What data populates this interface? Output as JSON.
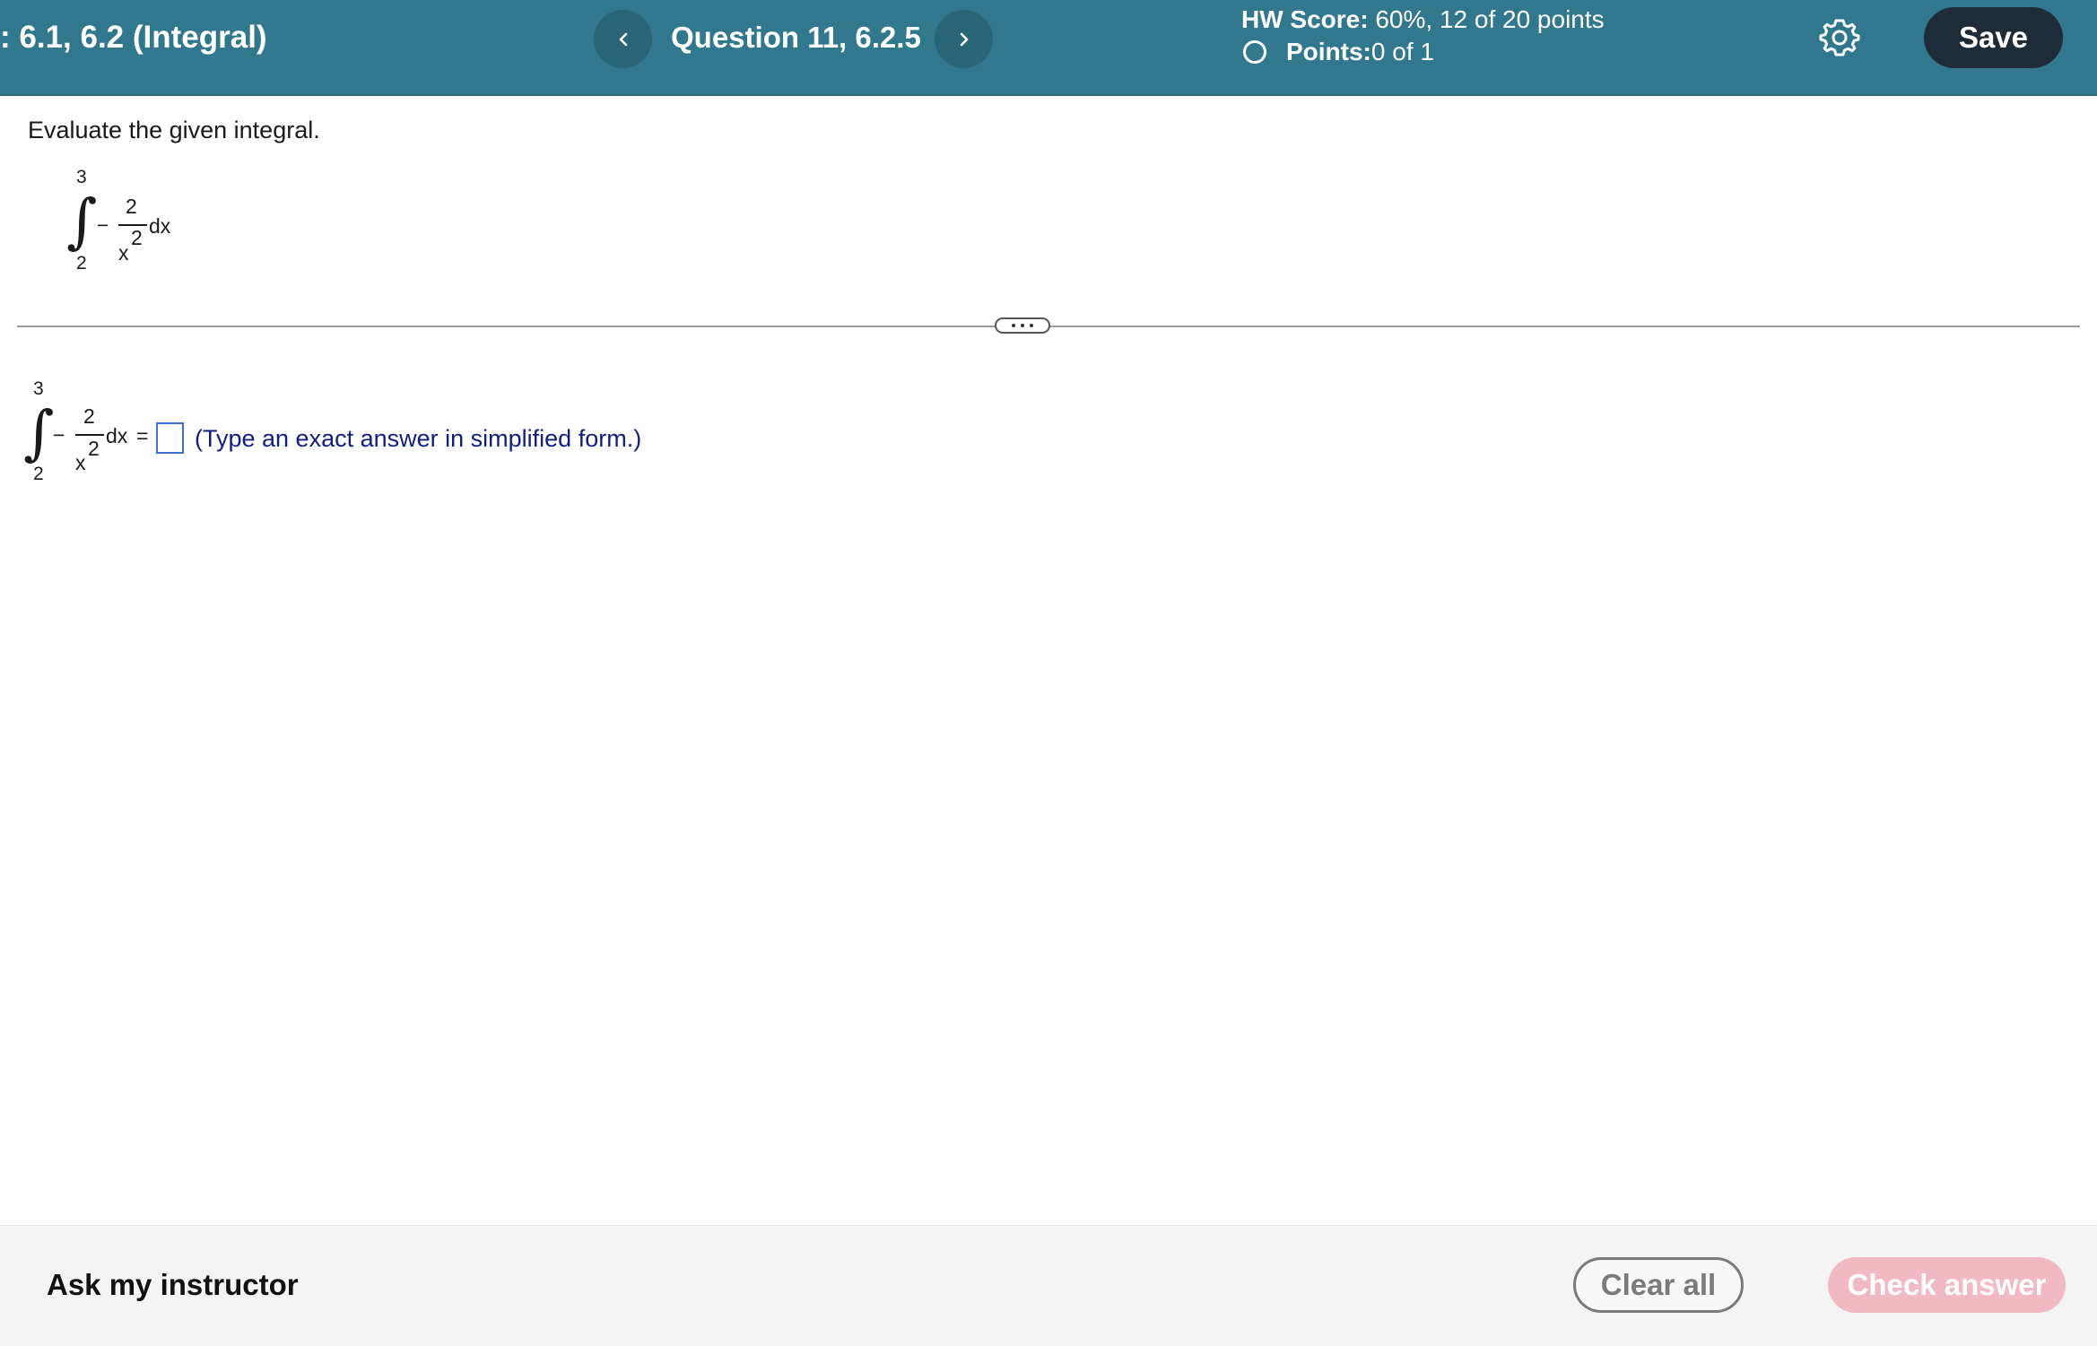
{
  "header": {
    "assignment_title": ": 6.1, 6.2 (Integral)",
    "prev_icon": "chevron-left-icon",
    "question_label": "Question 11, 6.2.5",
    "next_icon": "chevron-right-icon",
    "hw_score_label": "HW Score:",
    "hw_score_value": " 60%, 12 of 20 points",
    "points_label": "Points:",
    "points_value": " 0 of 1",
    "settings_icon": "gear-icon",
    "save_label": "Save"
  },
  "question": {
    "prompt": "Evaluate the given integral.",
    "integral": {
      "upper_limit": "3",
      "lower_limit": "2",
      "symbol": "∫",
      "sign": "−",
      "numerator": "2",
      "denominator_base": "x",
      "denominator_exponent": "2",
      "differential": "dx"
    }
  },
  "answer": {
    "integral": {
      "upper_limit": "3",
      "lower_limit": "2",
      "symbol": "∫",
      "sign": "−",
      "numerator": "2",
      "denominator_base": "x",
      "denominator_exponent": "2",
      "differential": "dx",
      "equals": "="
    },
    "input_value": "",
    "hint": "(Type an exact answer in simplified form.)"
  },
  "footer": {
    "ask_instructor": "Ask my instructor",
    "clear_all": "Clear all",
    "check_answer": "Check answer"
  },
  "colors": {
    "header_bg": "#31788f",
    "save_bg": "#1e2c3a",
    "hint_text": "#0f1e80",
    "answer_box_border": "#3b6fd6",
    "check_answer_bg": "#f1b9c1"
  }
}
